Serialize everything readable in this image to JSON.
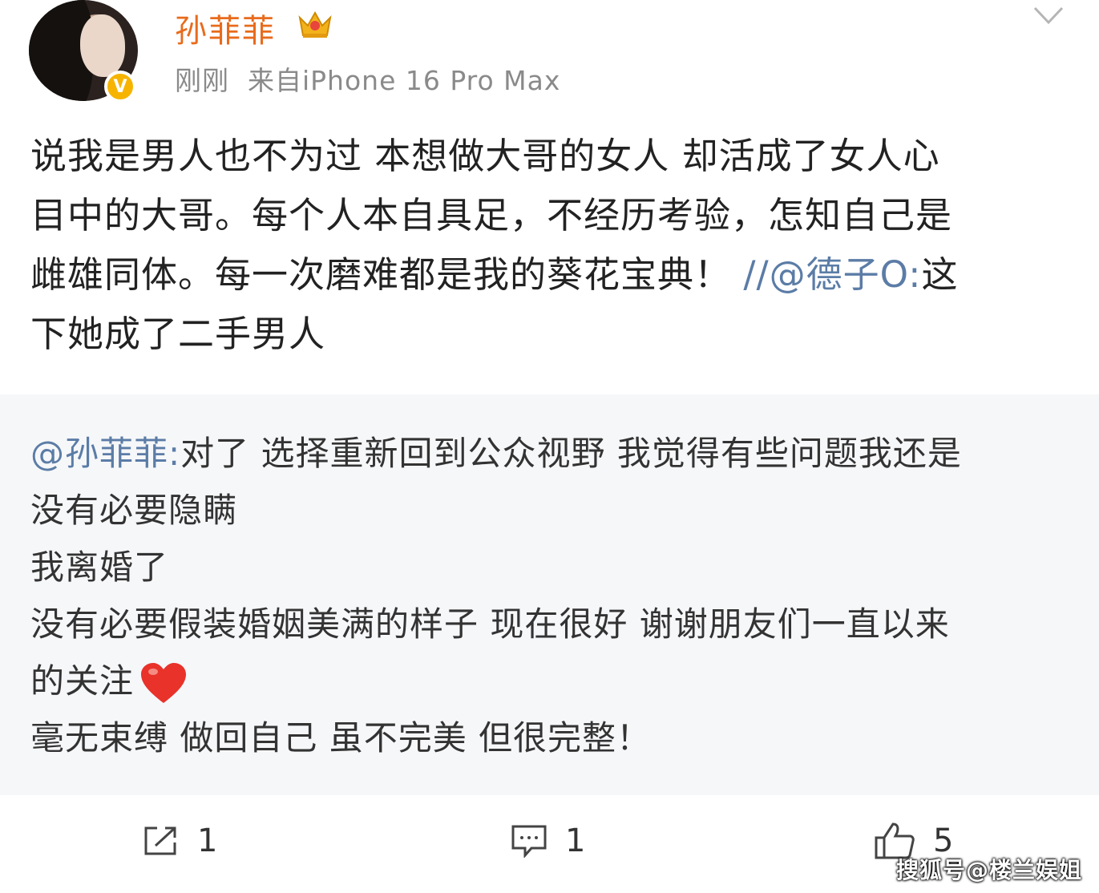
{
  "header": {
    "username": "孙菲菲",
    "meta": "刚刚  来自iPhone 16 Pro Max",
    "verified_badge": "V",
    "colors": {
      "username": "#e86b1c",
      "badge": "#f6b400"
    }
  },
  "post": {
    "lines": [
      "说我是男人也不为过 本想做大哥的女人 却活成了女人心",
      "目中的大哥。每个人本自具足，不经历考验，怎知自己是",
      "雌雄同体。每一次磨难都是我的葵花宝典！"
    ],
    "mention": "//@德子O:",
    "mention_tail": "这",
    "last_line": "下她成了二手男人"
  },
  "repost": {
    "mention": "@孙菲菲:",
    "line1_rest": "对了 选择重新回到公众视野 我觉得有些问题我还是",
    "lines": [
      "没有必要隐瞒",
      "我离婚了",
      "没有必要假装婚姻美满的样子 现在很好 谢谢朋友们一直以来"
    ],
    "line_heart": "的关注",
    "last_line": "毫无束缚 做回自己 虽不完美 但很完整！"
  },
  "actions": {
    "share_count": "1",
    "comment_count": "1",
    "like_count": "5",
    "icons": [
      "share-icon",
      "comment-icon",
      "like-icon"
    ]
  },
  "watermark": "搜狐号@楼兰娱姐"
}
